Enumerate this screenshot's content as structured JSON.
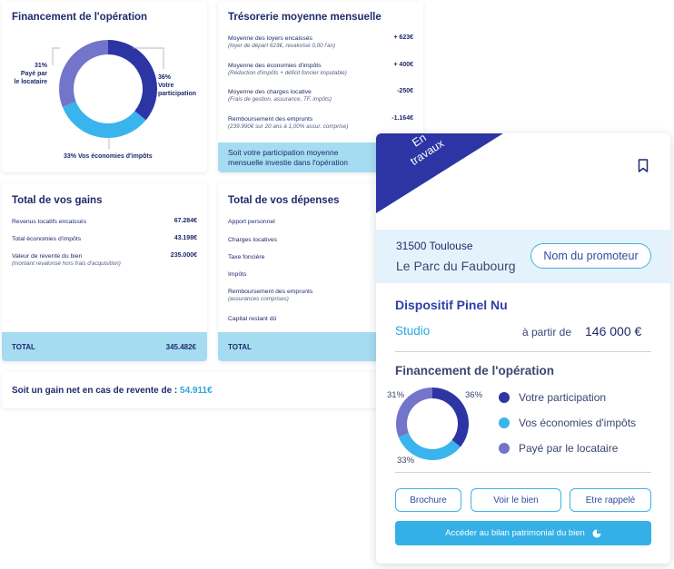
{
  "financement": {
    "title": "Financement de l'opération",
    "pct_left": "31%",
    "lbl_left_1": "Payé par",
    "lbl_left_2": "le locataire",
    "pct_right": "36%",
    "lbl_right_1": "Votre",
    "lbl_right_2": "participation",
    "bottom": "33% Vos économies d'impôts",
    "shares": [
      36,
      33,
      31
    ],
    "colors": [
      "#2c35a3",
      "#3ab4ec",
      "#7275c9"
    ]
  },
  "tresorerie": {
    "title": "Trésorerie moyenne mensuelle",
    "rows": [
      {
        "label": "Moyenne des loyers encaissés",
        "sub": "(loyer de départ 623€, revalorisé 0,00 l'an)",
        "value": "+ 623€"
      },
      {
        "label": "Moyenne des économies d'impôts",
        "sub": "(Réduction d'impôts + déficit foncier imputable)",
        "value": "+ 400€"
      },
      {
        "label": "Moyenne des charges locative",
        "sub": "(Frais de gestion, assurance, TF, impôts)",
        "value": "-250€"
      },
      {
        "label": "Remboursement des emprunts",
        "sub": "(239.990€ sur 20 ans à 1,00% assur. comprise)",
        "value": "-1.164€"
      }
    ],
    "band_1": "Soit votre participation moyenne",
    "band_2": "mensuelle investie dans l'opération"
  },
  "gains": {
    "title": "Total de vos gains",
    "rows": [
      {
        "label": "Revenus locatifs encaissés",
        "sub": "",
        "value": "67.284€"
      },
      {
        "label": "Total économies d'impôts",
        "sub": "",
        "value": "43.198€"
      },
      {
        "label": "Valeur de revente du bien",
        "sub": "(montant revalorisé hors frais d'acquisition)",
        "value": "235.000€"
      }
    ],
    "total_label": "TOTAL",
    "total_value": "345.482€"
  },
  "depenses": {
    "title": "Total de vos dépenses",
    "rows": [
      {
        "label": "Apport personnel",
        "sub": ""
      },
      {
        "label": "Charges locatives",
        "sub": ""
      },
      {
        "label": "Taxe foncière",
        "sub": ""
      },
      {
        "label": "Impôts",
        "sub": ""
      },
      {
        "label": "Remboursement des emprunts",
        "sub": "(assurances comprises)"
      },
      {
        "label": "Capital restant dû",
        "sub": ""
      }
    ],
    "total_label": "TOTAL"
  },
  "gain_net": {
    "label": "Soit un gain net en cas de revente de :",
    "value": "54.911€"
  },
  "property": {
    "ribbon_1": "En",
    "ribbon_2": "travaux",
    "postal_city": "31500 Toulouse",
    "program": "Le Parc du Faubourg",
    "promoter_button": "Nom du promoteur",
    "dispositif": "Dispositif Pinel Nu",
    "type": "Studio",
    "price_prefix": "à partir de",
    "price": "146 000 €",
    "fin_title": "Financement de l'opération",
    "pct_left": "31%",
    "pct_right": "36%",
    "pct_bottom": "33%",
    "legend": [
      {
        "label": "Votre participation",
        "color": "#2c35a3"
      },
      {
        "label": "Vos économies d'impôts",
        "color": "#3ab4ec"
      },
      {
        "label": "Payé par le locataire",
        "color": "#7275c9"
      }
    ],
    "btn_brochure": "Brochure",
    "btn_voir": "Voir le bien",
    "btn_rappel": "Etre rappelé",
    "btn_bilan": "Accéder au bilan patrimonial du bien"
  }
}
